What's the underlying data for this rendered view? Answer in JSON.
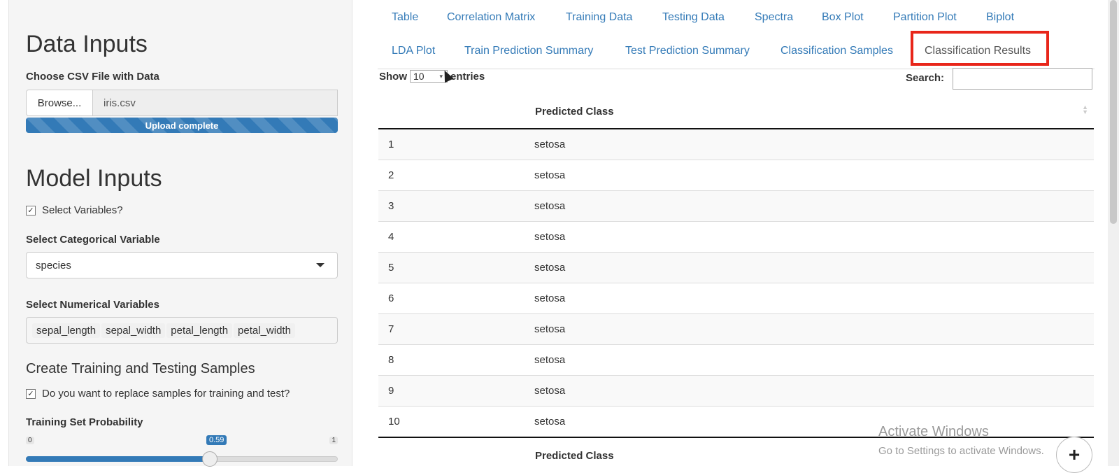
{
  "sidebar": {
    "data_inputs_title": "Data Inputs",
    "file_label": "Choose CSV File with Data",
    "browse_label": "Browse...",
    "file_name": "iris.csv",
    "upload_status": "Upload complete",
    "model_inputs_title": "Model Inputs",
    "select_variables_label": "Select Variables?",
    "select_variables_checked": true,
    "categorical_label": "Select Categorical Variable",
    "categorical_value": "species",
    "numerical_label": "Select Numerical Variables",
    "numerical_values": [
      "sepal_length",
      "sepal_width",
      "petal_length",
      "petal_width"
    ],
    "samples_title": "Create Training and Testing Samples",
    "replace_label": "Do you want to replace samples for training and test?",
    "replace_checked": true,
    "training_prob_label": "Training Set Probability",
    "slider": {
      "min": "0",
      "max": "1",
      "value": "0.59",
      "fraction": 0.59
    }
  },
  "tabs": [
    "Table",
    "Correlation Matrix",
    "Training Data",
    "Testing Data",
    "Spectra",
    "Box Plot",
    "Partition Plot",
    "Biplot",
    "LDA Plot",
    "Train Prediction Summary",
    "Test Prediction Summary",
    "Classification Samples",
    "Classification Results"
  ],
  "active_tab": "Classification Results",
  "highlight_color": "#e8261a",
  "accent_color": "#337ab7",
  "datatable": {
    "show_label": "Show",
    "entries_value": "10",
    "entries_label": "entries",
    "search_label": "Search:",
    "column_header": "Predicted Class",
    "rows": [
      [
        "1",
        "setosa"
      ],
      [
        "2",
        "setosa"
      ],
      [
        "3",
        "setosa"
      ],
      [
        "4",
        "setosa"
      ],
      [
        "5",
        "setosa"
      ],
      [
        "6",
        "setosa"
      ],
      [
        "7",
        "setosa"
      ],
      [
        "8",
        "setosa"
      ],
      [
        "9",
        "setosa"
      ],
      [
        "10",
        "setosa"
      ]
    ]
  },
  "watermark": {
    "line1": "Activate Windows",
    "line2": "Go to Settings to activate Windows."
  }
}
